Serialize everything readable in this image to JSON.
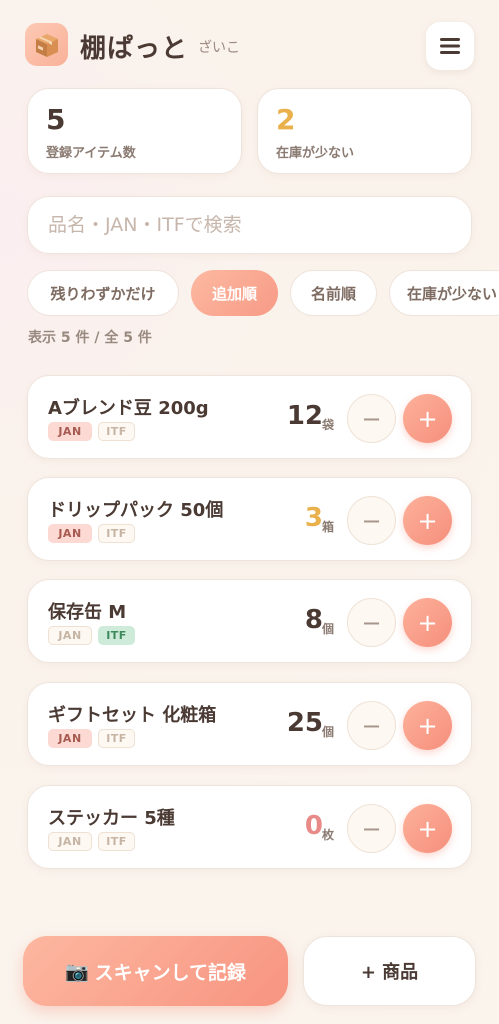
{
  "app": {
    "title": "棚ぱっと",
    "user": "ざいこ",
    "logo_icon": "package-box-icon",
    "menu_icon": "hamburger-icon"
  },
  "stats": [
    {
      "value": "5",
      "label": "登録アイテム数",
      "color": "#4a3a33"
    },
    {
      "value": "2",
      "label": "在庫が少ない",
      "color": "#e9b04b"
    }
  ],
  "search": {
    "placeholder": "品名・JAN・ITFで検索",
    "value": ""
  },
  "sort_chips": [
    {
      "label": "残りわずかだけ",
      "active": false
    },
    {
      "label": "追加順",
      "active": true
    },
    {
      "label": "名前順",
      "active": false
    },
    {
      "label": "在庫が少ない",
      "active": false
    }
  ],
  "count_text": "表示 5 件 / 全 5 件",
  "items": [
    {
      "name": "Aブレンド豆 200g",
      "qty": "12",
      "unit": "袋",
      "qty_color": "#4a3a33",
      "jan": true,
      "itf": false
    },
    {
      "name": "ドリップパック 50個",
      "qty": "3",
      "unit": "箱",
      "qty_color": "#e9b04b",
      "jan": true,
      "itf": false
    },
    {
      "name": "保存缶 M",
      "qty": "8",
      "unit": "個",
      "qty_color": "#4a3a33",
      "jan": false,
      "itf": true
    },
    {
      "name": "ギフトセット 化粧箱",
      "qty": "25",
      "unit": "個",
      "qty_color": "#4a3a33",
      "jan": true,
      "itf": false
    },
    {
      "name": "ステッカー 5種",
      "qty": "0",
      "unit": "枚",
      "qty_color": "#e88a88",
      "jan": false,
      "itf": false
    }
  ],
  "tag_labels": {
    "jan": "JAN",
    "itf": "ITF"
  },
  "buttons": {
    "minus": "−",
    "plus": "+"
  },
  "scan_button": {
    "icon": "📷",
    "label": "スキャンして記録"
  },
  "add_button": {
    "label": "+ 商品"
  }
}
